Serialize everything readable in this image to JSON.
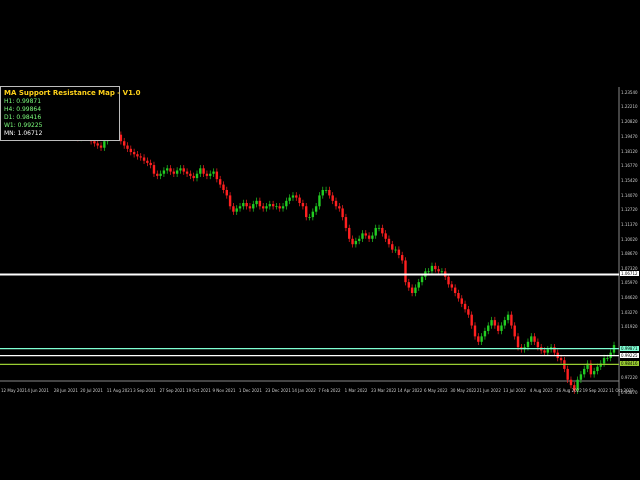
{
  "indicator": {
    "title": "MA Support Resistance Map - V1.0",
    "rows": [
      {
        "key": "h1",
        "text": "H1: 0.99871"
      },
      {
        "key": "h4",
        "text": "H4: 0.99864"
      },
      {
        "key": "d1",
        "text": "D1: 0.98416"
      },
      {
        "key": "w1",
        "text": "W1: 0.99225"
      },
      {
        "key": "mn",
        "text": "MN: 1.06712"
      }
    ]
  },
  "price_axis": [
    "1.23540",
    "1.22210",
    "1.20820",
    "1.19470",
    "1.18120",
    "1.16770",
    "1.15420",
    "1.14070",
    "1.12720",
    "1.11370",
    "1.10020",
    "1.08670",
    "1.07320",
    "1.06712",
    "1.05970",
    "1.04620",
    "1.03270",
    "1.01920",
    "0.99871",
    "0.99225",
    "0.98416",
    "0.97220",
    "0.95870"
  ],
  "date_axis": [
    "12 May 2021",
    "4 Jun 2021",
    "28 Jun 2021",
    "20 Jul 2021",
    "11 Aug 2021",
    "3 Sep 2021",
    "27 Sep 2021",
    "19 Oct 2021",
    "9 Nov 2021",
    "1 Dec 2021",
    "23 Dec 2021",
    "14 Jan 2022",
    "7 Feb 2022",
    "1 Mar 2022",
    "23 Mar 2022",
    "14 Apr 2022",
    "6 May 2022",
    "30 May 2022",
    "21 Jun 2022",
    "13 Jul 2022",
    "4 Aug 2022",
    "26 Aug 2022",
    "19 Sep 2022",
    "11 Oct 2022"
  ],
  "chart_data": {
    "type": "candlestick",
    "ylim": [
      0.955,
      1.24
    ],
    "levels": [
      {
        "name": "MN",
        "value": 1.06712,
        "color": "#ffffff"
      },
      {
        "name": "H1",
        "value": 0.99871,
        "color": "#7fffd4"
      },
      {
        "name": "W1",
        "value": 0.99225,
        "color": "#ffffff"
      },
      {
        "name": "D1",
        "value": 0.98416,
        "color": "#9acd32"
      }
    ],
    "closes": [
      1.215,
      1.212,
      1.21,
      1.205,
      1.2,
      1.196,
      1.193,
      1.198,
      1.2,
      1.195,
      1.19,
      1.188,
      1.186,
      1.184,
      1.19,
      1.195,
      1.198,
      1.202,
      1.196,
      1.19,
      1.186,
      1.183,
      1.18,
      1.178,
      1.176,
      1.175,
      1.172,
      1.17,
      1.168,
      1.16,
      1.158,
      1.16,
      1.163,
      1.165,
      1.162,
      1.16,
      1.163,
      1.165,
      1.162,
      1.16,
      1.158,
      1.156,
      1.16,
      1.165,
      1.16,
      1.158,
      1.16,
      1.162,
      1.155,
      1.15,
      1.145,
      1.14,
      1.13,
      1.125,
      1.128,
      1.13,
      1.133,
      1.13,
      1.128,
      1.132,
      1.135,
      1.13,
      1.128,
      1.13,
      1.132,
      1.13,
      1.13,
      1.128,
      1.13,
      1.135,
      1.138,
      1.14,
      1.138,
      1.133,
      1.13,
      1.12,
      1.12,
      1.125,
      1.13,
      1.14,
      1.145,
      1.145,
      1.14,
      1.135,
      1.13,
      1.128,
      1.12,
      1.11,
      1.1,
      1.095,
      1.098,
      1.1,
      1.105,
      1.103,
      1.1,
      1.103,
      1.11,
      1.11,
      1.105,
      1.1,
      1.095,
      1.09,
      1.09,
      1.085,
      1.08,
      1.06,
      1.055,
      1.05,
      1.055,
      1.06,
      1.065,
      1.07,
      1.07,
      1.075,
      1.072,
      1.07,
      1.07,
      1.065,
      1.058,
      1.055,
      1.05,
      1.045,
      1.04,
      1.035,
      1.03,
      1.02,
      1.01,
      1.005,
      1.01,
      1.015,
      1.02,
      1.025,
      1.02,
      1.015,
      1.02,
      1.025,
      1.03,
      1.02,
      1.01,
      1.0,
      0.998,
      1.0,
      1.005,
      1.01,
      1.005,
      1.0,
      0.997,
      0.995,
      0.998,
      1.0,
      0.995,
      0.99,
      0.988,
      0.98,
      0.97,
      0.965,
      0.96,
      0.97,
      0.975,
      0.98,
      0.985,
      0.975,
      0.978,
      0.982,
      0.985,
      0.99,
      0.99,
      0.995,
      1.002
    ]
  }
}
